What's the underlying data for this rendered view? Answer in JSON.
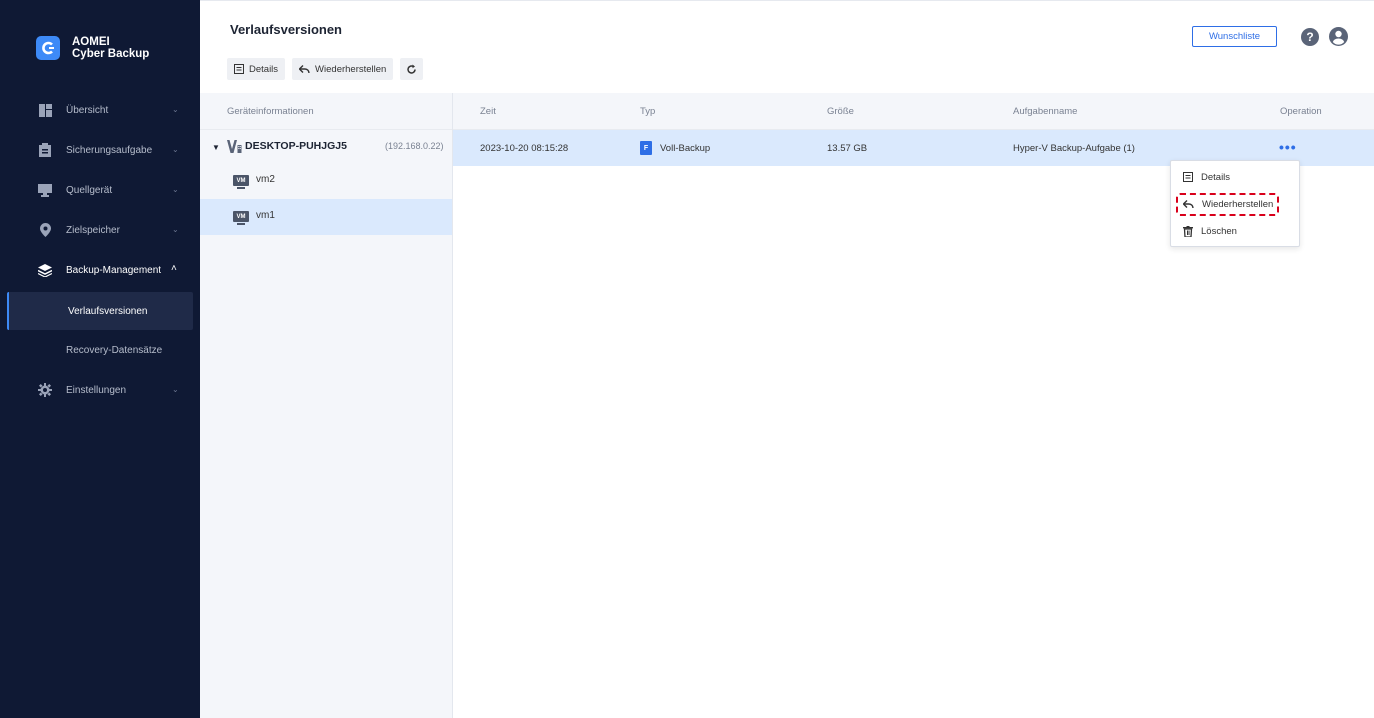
{
  "app": {
    "logo_line1": "AOMEI",
    "logo_line2": "Cyber Backup"
  },
  "sidebar": {
    "items": [
      {
        "label": "Übersicht",
        "icon": "dashboard-icon"
      },
      {
        "label": "Sicherungsaufgabe",
        "icon": "clipboard-icon"
      },
      {
        "label": "Quellgerät",
        "icon": "monitor-icon"
      },
      {
        "label": "Zielspeicher",
        "icon": "location-pin-icon"
      },
      {
        "label": "Backup-Management",
        "icon": "layers-icon"
      },
      {
        "label": "Einstellungen",
        "icon": "gear-icon"
      }
    ],
    "sub_items": [
      {
        "label": "Verlaufsversionen"
      },
      {
        "label": "Recovery-Datensätze"
      }
    ]
  },
  "header": {
    "title": "Verlaufsversionen",
    "toolbar": {
      "details_label": "Details",
      "restore_label": "Wiederherstellen"
    },
    "wishlist_label": "Wunschliste",
    "help_glyph": "?"
  },
  "device_panel": {
    "header": "Geräteinformationen",
    "device": {
      "name": "DESKTOP-PUHJGJ5",
      "ip": "(192.168.0.22)"
    },
    "vms": [
      {
        "badge": "VM",
        "name": "vm2"
      },
      {
        "badge": "VM",
        "name": "vm1"
      }
    ]
  },
  "table": {
    "columns": {
      "time": "Zeit",
      "type": "Typ",
      "size": "Größe",
      "task": "Aufgabenname",
      "operation": "Operation"
    },
    "rows": [
      {
        "time": "2023-10-20 08:15:28",
        "type_badge": "F",
        "type": "Voll-Backup",
        "size": "13.57 GB",
        "task": "Hyper-V Backup-Aufgabe (1)",
        "operation": "•••"
      }
    ]
  },
  "dropdown": {
    "items": [
      {
        "label": "Details",
        "icon": "details-icon"
      },
      {
        "label": "Wiederherstellen",
        "icon": "restore-icon"
      },
      {
        "label": "Löschen",
        "icon": "trash-icon"
      }
    ]
  },
  "colors": {
    "sidebar_bg": "#0f1934",
    "accent": "#2e6ee6",
    "selection": "#dae9fd",
    "highlight": "#d9001b"
  }
}
